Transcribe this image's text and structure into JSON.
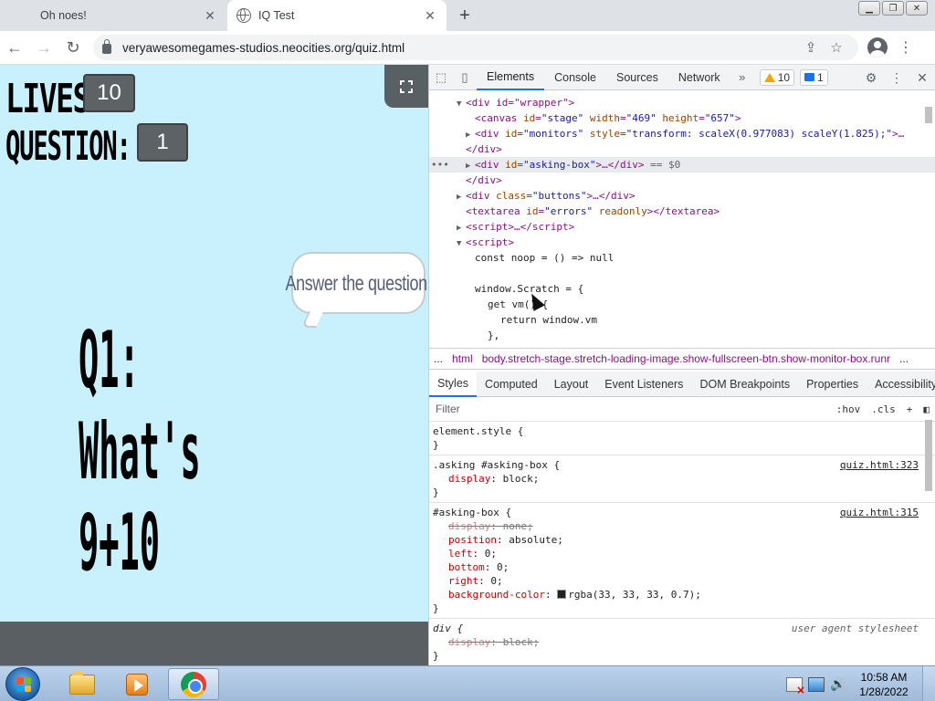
{
  "browser": {
    "tabs": [
      {
        "title": "Oh noes!",
        "active": false
      },
      {
        "title": "IQ Test",
        "active": true
      }
    ],
    "new_tab_glyph": "+",
    "url": "veryawesomegames-studios.neocities.org/quiz.html",
    "icons": {
      "back": "arrow-left-icon",
      "forward": "arrow-right-icon",
      "reload": "reload-icon",
      "lock": "lock-icon",
      "share": "share-icon",
      "bookmark": "star-icon",
      "profile": "profile-icon",
      "menu": "kebab-menu-icon"
    }
  },
  "stage": {
    "lives_label": "LIVES:",
    "lives_value": "10",
    "question_label": "QUESTION:",
    "question_value": "1",
    "speech_bubble": "Answer the question!",
    "question_text": "Q1: What's 9+10",
    "background": "#c8f1fd",
    "monitor_color": "#5d6264"
  },
  "devtools": {
    "tabs": [
      "Elements",
      "Console",
      "Sources",
      "Network"
    ],
    "active_tab": "Elements",
    "warnings_count": "10",
    "messages_count": "1",
    "dom": {
      "wrapper_open": "<div id=\"wrapper\">",
      "canvas_tag": "canvas",
      "canvas_id": "\"stage\"",
      "canvas_width": "\"469\"",
      "canvas_height": "\"657\"",
      "monitors_id": "\"monitors\"",
      "monitors_style": "\"transform: scaleX(0.977083) scaleY(1.825);\"",
      "div_close": "</div>",
      "asking_box_id": "\"asking-box\"",
      "selected_marker": "== $0",
      "buttons_class": "\"buttons\"",
      "errors_id": "\"errors\"",
      "readonly_attr": "readonly",
      "script_tag": "script",
      "js_line1": "const noop = () => null",
      "js_line2": "window.Scratch = {",
      "js_line3": "get vm() {",
      "js_line4": "return window.vm",
      "js_line5": "},"
    },
    "breadcrumbs": [
      "...",
      "html",
      "body.stretch-stage.stretch-loading-image.show-fullscreen-btn.show-monitor-box.runr",
      "..."
    ],
    "style_tabs": [
      "Styles",
      "Computed",
      "Layout",
      "Event Listeners",
      "DOM Breakpoints",
      "Properties",
      "Accessibility"
    ],
    "active_style_tab": "Styles",
    "filter_placeholder": "Filter",
    "hov_label": ":hov",
    "cls_label": ".cls",
    "rules": [
      {
        "selector": "element.style {",
        "source": "",
        "props": [],
        "close": "}"
      },
      {
        "selector": ".asking #asking-box {",
        "source": "quiz.html:323",
        "props": [
          {
            "name": "display",
            "value": "block;",
            "strike": false
          }
        ],
        "close": "}"
      },
      {
        "selector": "#asking-box {",
        "source": "quiz.html:315",
        "props": [
          {
            "name": "display",
            "value": "none;",
            "strike": true
          },
          {
            "name": "position",
            "value": "absolute;",
            "strike": false
          },
          {
            "name": "left",
            "value": "0;",
            "strike": false
          },
          {
            "name": "bottom",
            "value": "0;",
            "strike": false
          },
          {
            "name": "right",
            "value": "0;",
            "strike": false
          },
          {
            "name": "background-color",
            "value": "rgba(33, 33, 33, 0.7);",
            "strike": false
          }
        ],
        "close": "}"
      },
      {
        "selector": "div {",
        "source": "user agent stylesheet",
        "props": [
          {
            "name": "display",
            "value": "block;",
            "strike": true
          }
        ],
        "close": "}"
      }
    ]
  },
  "taskbar": {
    "time": "10:58 AM",
    "date": "1/28/2022",
    "apps": [
      "windows-explorer-icon",
      "media-player-icon",
      "chrome-icon"
    ]
  }
}
